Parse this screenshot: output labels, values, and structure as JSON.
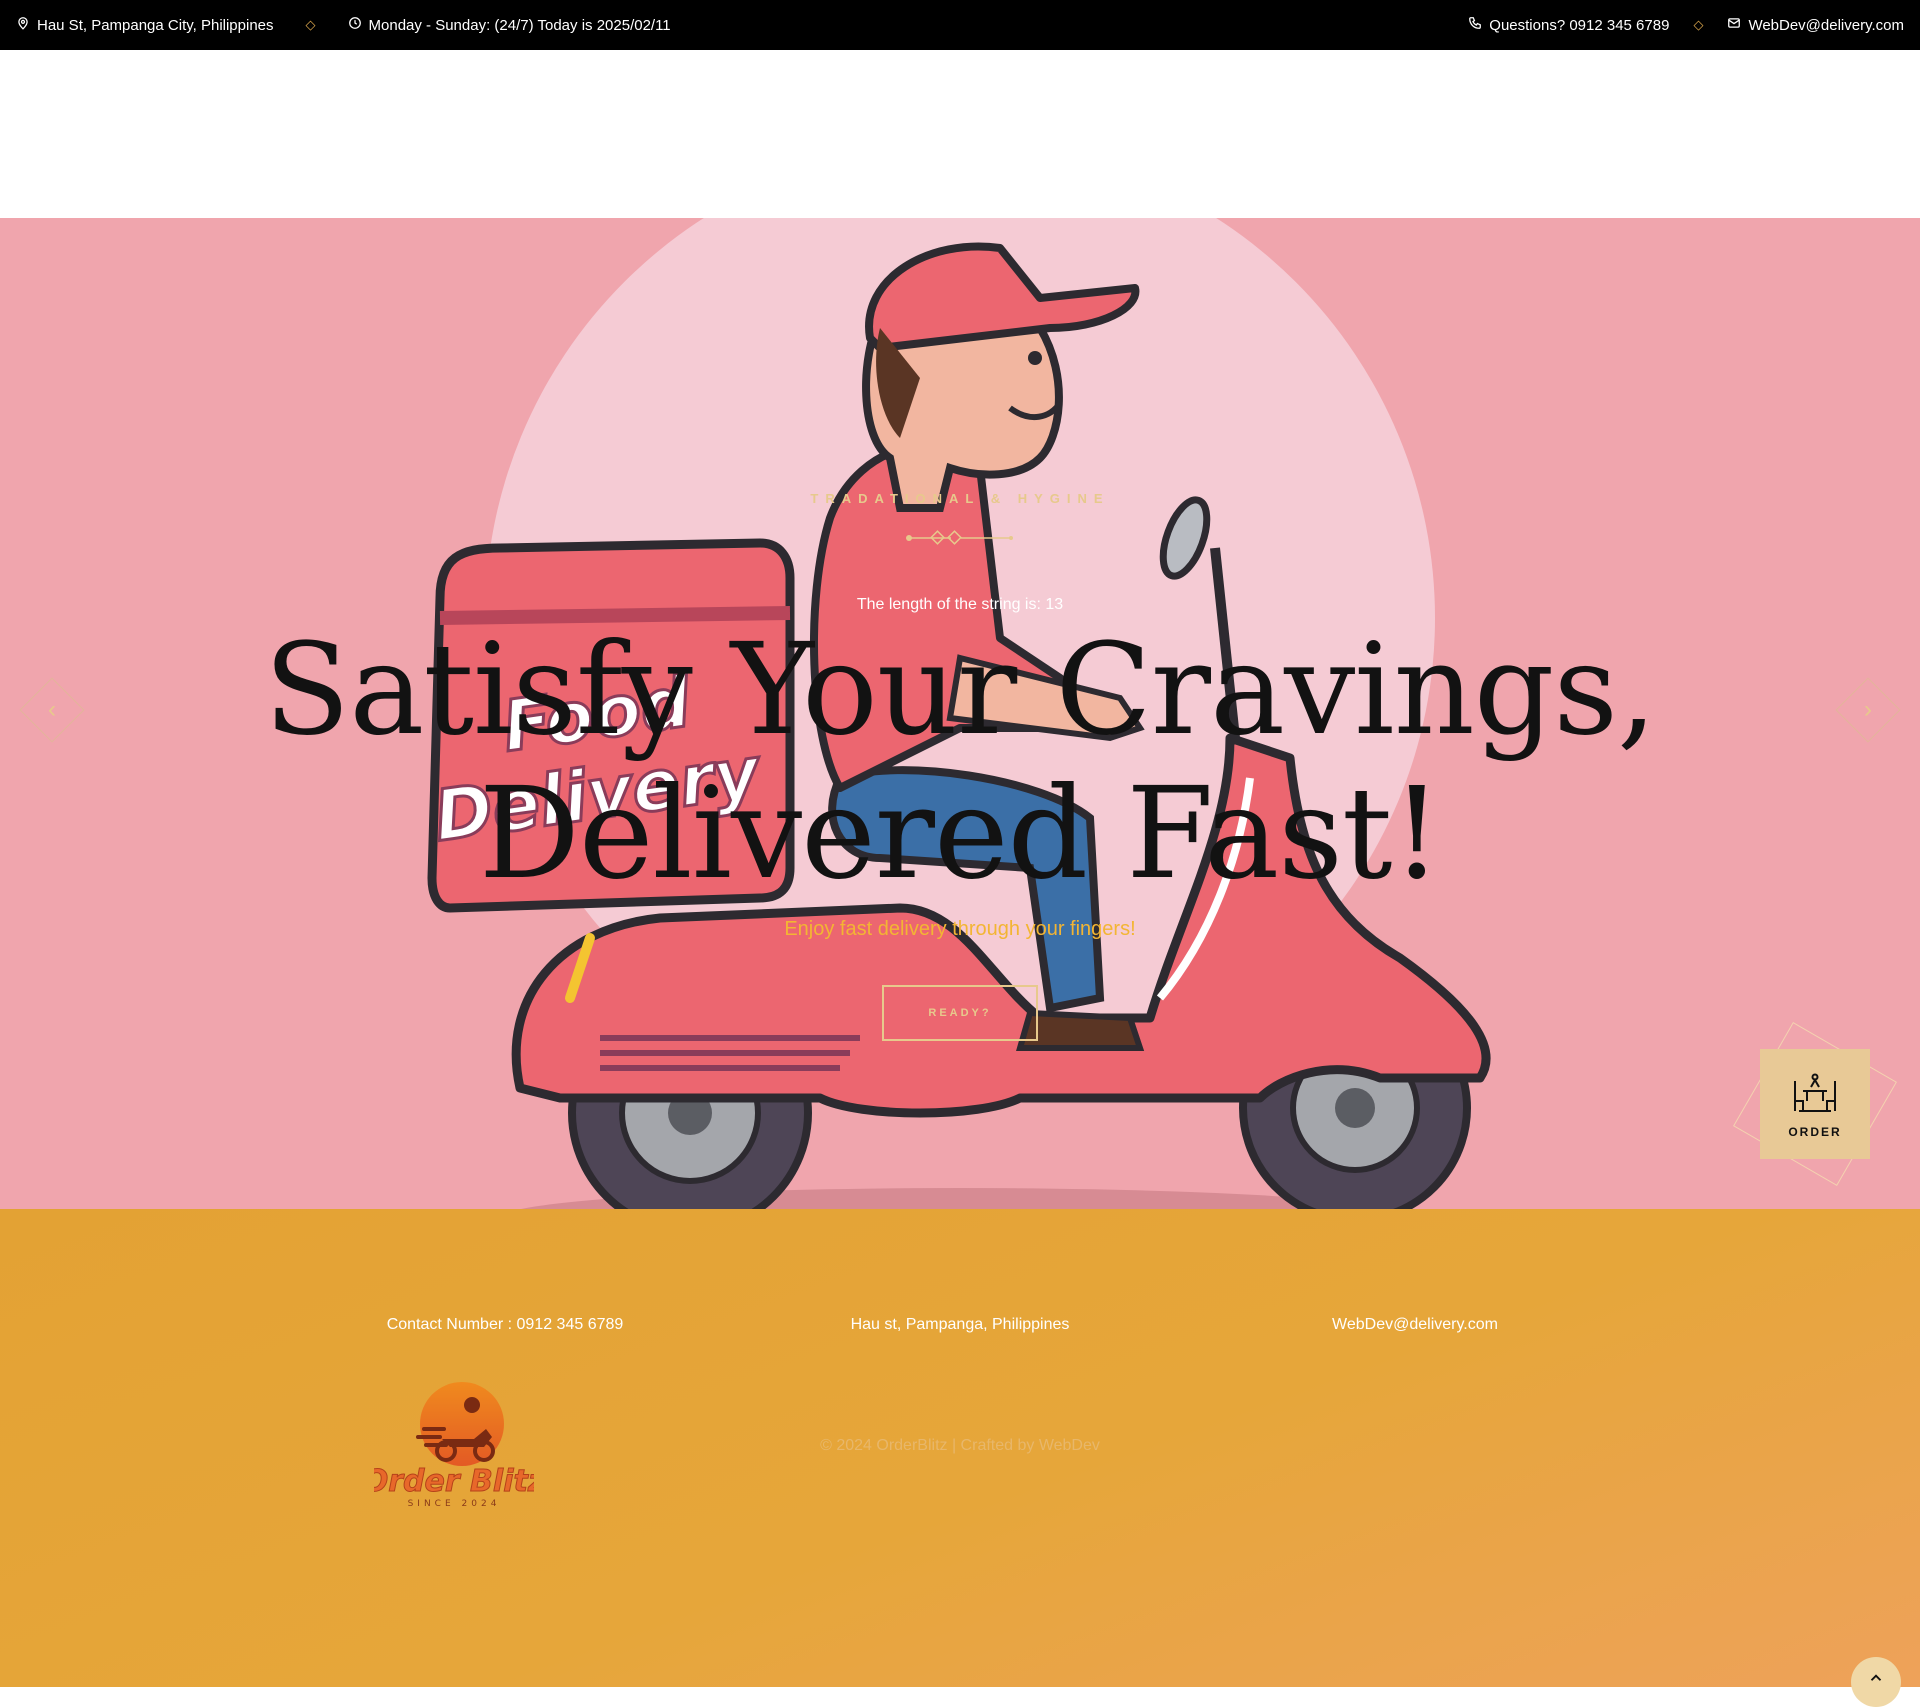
{
  "topbar": {
    "address": "Hau St, Pampanga City, Philippines",
    "hours": "Monday - Sunday: (24/7) Today is 2025/02/11",
    "phone": "Questions? 0912 345 6789",
    "email": "WebDev@delivery.com",
    "separator": "◇"
  },
  "hero": {
    "subtitle": "TRADATIONAL & HYGINE",
    "string_length_text": "The length of the string is: 13",
    "headline_line1": "Satisfy Your Cravings,",
    "headline_line2": "Delivered Fast!",
    "tagline": "Enjoy fast delivery through your fingers!",
    "cta_label": "READY?",
    "prev_arrow": "‹",
    "next_arrow": "›",
    "box_text_line1": "Food",
    "box_text_line2": "Delivery"
  },
  "order_badge": {
    "label": "ORDER"
  },
  "footer": {
    "contact_number": "Contact Number : 0912 345 6789",
    "address": "Hau st, Pampanga, Philippines",
    "email": "WebDev@delivery.com",
    "copyright": "© 2024 OrderBlitz | Crafted by WebDev",
    "logo_text": "Order Blitz",
    "logo_since": "SINCE 2024"
  },
  "colors": {
    "hero_bg": "#f0a5ad",
    "accent_gold": "#e7c98c",
    "tagline_yellow": "#f3b533",
    "footer_orange": "#e3a234",
    "scooter_red": "#ec6670"
  }
}
